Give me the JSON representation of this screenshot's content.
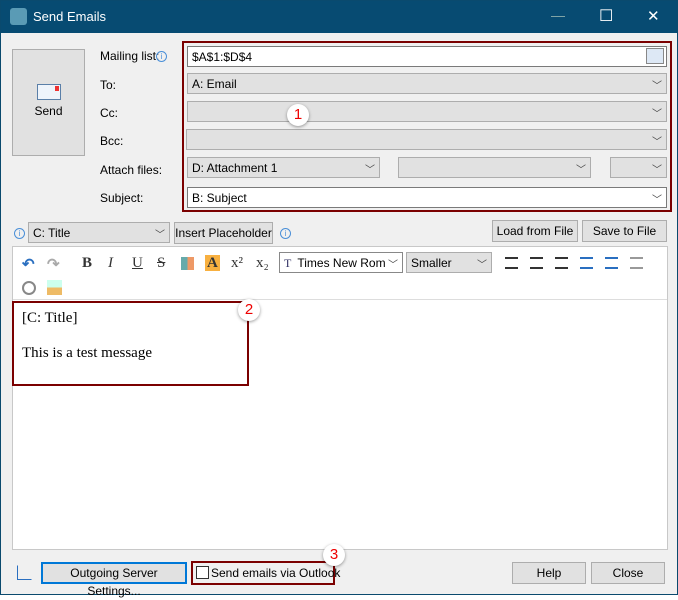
{
  "window": {
    "title": "Send Emails",
    "minimize": "—",
    "maximize": "☐",
    "close": "✕"
  },
  "send_button": {
    "label": "Send"
  },
  "fields": {
    "mailing_list": {
      "label": "Mailing list:",
      "value": "$A$1:$D$4"
    },
    "to": {
      "label": "To:",
      "value": "A: Email"
    },
    "cc": {
      "label": "Cc:",
      "value": ""
    },
    "bcc": {
      "label": "Bcc:",
      "value": ""
    },
    "attach": {
      "label": "Attach files:",
      "values": [
        "D: Attachment 1",
        "",
        ""
      ]
    },
    "subject": {
      "label": "Subject:",
      "value": "B: Subject"
    }
  },
  "placeholder": {
    "combo": "C: Title",
    "insert": "Insert Placeholder",
    "load": "Load from File",
    "save": "Save to File"
  },
  "toolbar": {
    "font": "Times New Rom",
    "size": "Smaller",
    "bold": "B",
    "italic": "I",
    "underline": "U",
    "strike": "S",
    "highlight": "A",
    "superscript": "x²",
    "subscript": "x₂"
  },
  "editor": {
    "lines": [
      "[C: Title]",
      "This is a test message"
    ]
  },
  "badges": [
    "1",
    "2",
    "3"
  ],
  "footer": {
    "outgoing": "Outgoing Server Settings...",
    "outlook": "Send emails via Outlook",
    "outlook_checked": false,
    "help": "Help",
    "close": "Close"
  },
  "colors": {
    "titlebar": "#074b72",
    "highlight_box": "#7b0000",
    "badge_text": "#ee0000"
  }
}
